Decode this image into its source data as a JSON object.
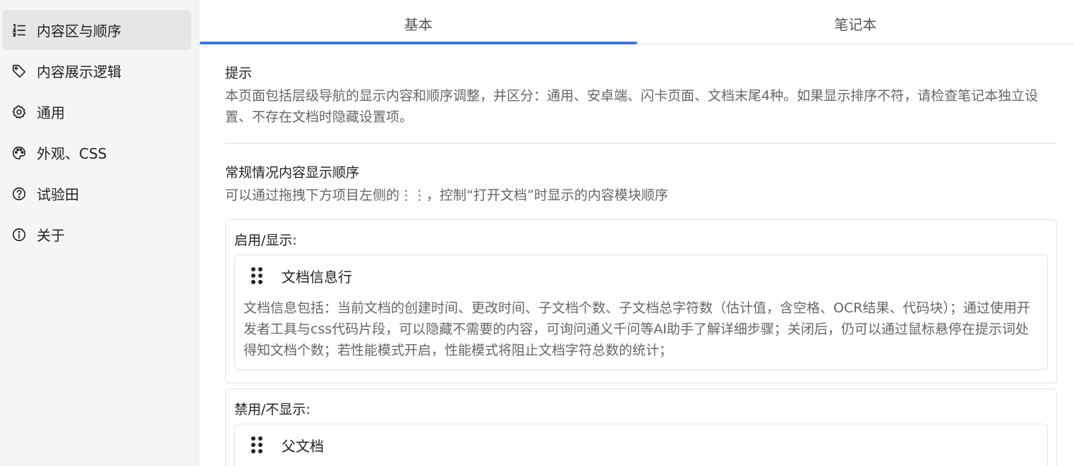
{
  "sidebar": {
    "items": [
      {
        "label": "内容区与顺序",
        "icon": "list-ordered-icon",
        "active": true
      },
      {
        "label": "内容展示逻辑",
        "icon": "tag-icon",
        "active": false
      },
      {
        "label": "通用",
        "icon": "gear-icon",
        "active": false
      },
      {
        "label": "外观、CSS",
        "icon": "palette-icon",
        "active": false
      },
      {
        "label": "试验田",
        "icon": "question-circle-icon",
        "active": false
      },
      {
        "label": "关于",
        "icon": "info-circle-icon",
        "active": false
      }
    ]
  },
  "tabs": [
    {
      "label": "基本",
      "active": true
    },
    {
      "label": "笔记本",
      "active": false
    }
  ],
  "hint": {
    "title": "提示",
    "desc": "本页面包括层级导航的显示内容和顺序调整，并区分：通用、安卓端、闪卡页面、文档末尾4种。如果显示排序不符，请检查笔记本独立设置、不存在文档时隐藏设置项。"
  },
  "order": {
    "title": "常规情况内容显示顺序",
    "desc": "可以通过拖拽下方项目左侧的⋮⋮，控制“打开文档”时显示的内容模块顺序"
  },
  "enabled": {
    "label": "启用/显示:",
    "items": [
      {
        "title": "文档信息行",
        "desc": "文档信息包括：当前文档的创建时间、更改时间、子文档个数、子文档总字符数（估计值，含空格、OCR结果、代码块）；通过使用开发者工具与css代码片段，可以隐藏不需要的内容，可询问通义千问等AI助手了解详细步骤；关闭后，仍可以通过鼠标悬停在提示词处得知文档个数；若性能模式开启，性能模式将阻止文档字符总数的统计；"
      }
    ]
  },
  "disabled": {
    "label": "禁用/不显示:",
    "items": [
      {
        "title": "父文档"
      }
    ]
  },
  "colors": {
    "accent": "#3b78e7",
    "sidebar_bg": "#f5f5f5",
    "active_item_bg": "#e6e6e6"
  }
}
